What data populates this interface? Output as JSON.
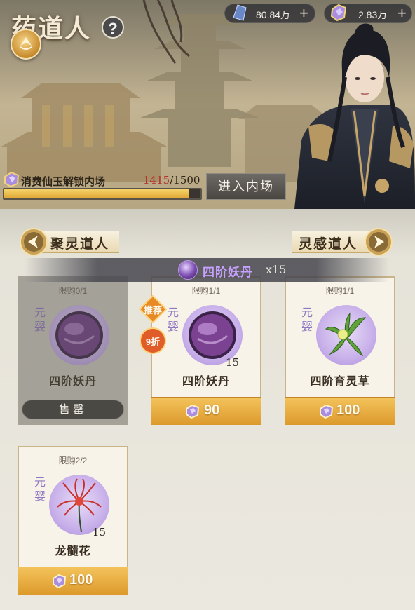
{
  "header": {
    "title": "药道人",
    "help_icon": "question-mark-icon",
    "emblem_icon": "shop-emblem-icon"
  },
  "resources": [
    {
      "icon": "spirit-stone-icon",
      "value": "80.84万",
      "plus": "+"
    },
    {
      "icon": "immortal-jade-icon",
      "value": "2.83万",
      "plus": "+"
    }
  ],
  "unlock": {
    "label": "消费仙玉解锁内场",
    "current": "1415",
    "separator": "/",
    "total": "1500",
    "progress_fraction": 0.943,
    "button_label": "进入内场"
  },
  "nav": {
    "left_label": "聚灵道人",
    "right_label": "灵感道人"
  },
  "banner": {
    "item": "四阶妖丹",
    "multiplier": "x15"
  },
  "cards": [
    {
      "limit": "限购0/1",
      "realm": "元婴",
      "name": "四阶妖丹",
      "qty": "",
      "status": "售罄",
      "price": "",
      "sold_out": true
    },
    {
      "limit": "限购1/1",
      "realm": "元婴",
      "name": "四阶妖丹",
      "qty": "15",
      "price": "90",
      "tags": [
        "推荐",
        "9折"
      ],
      "sold_out": false
    },
    {
      "limit": "限购1/1",
      "realm": "元婴",
      "name": "四阶育灵草",
      "qty": "",
      "price": "100",
      "sold_out": false
    },
    {
      "limit": "限购2/2",
      "realm": "元婴",
      "name": "龙髓花",
      "qty": "15",
      "price": "100",
      "sold_out": false
    }
  ],
  "colors": {
    "price_bar": "#e6a83a",
    "realm_text": "#8f77c2",
    "banner_text": "#c8a0ff",
    "progress_fill": "#f0c24e"
  }
}
